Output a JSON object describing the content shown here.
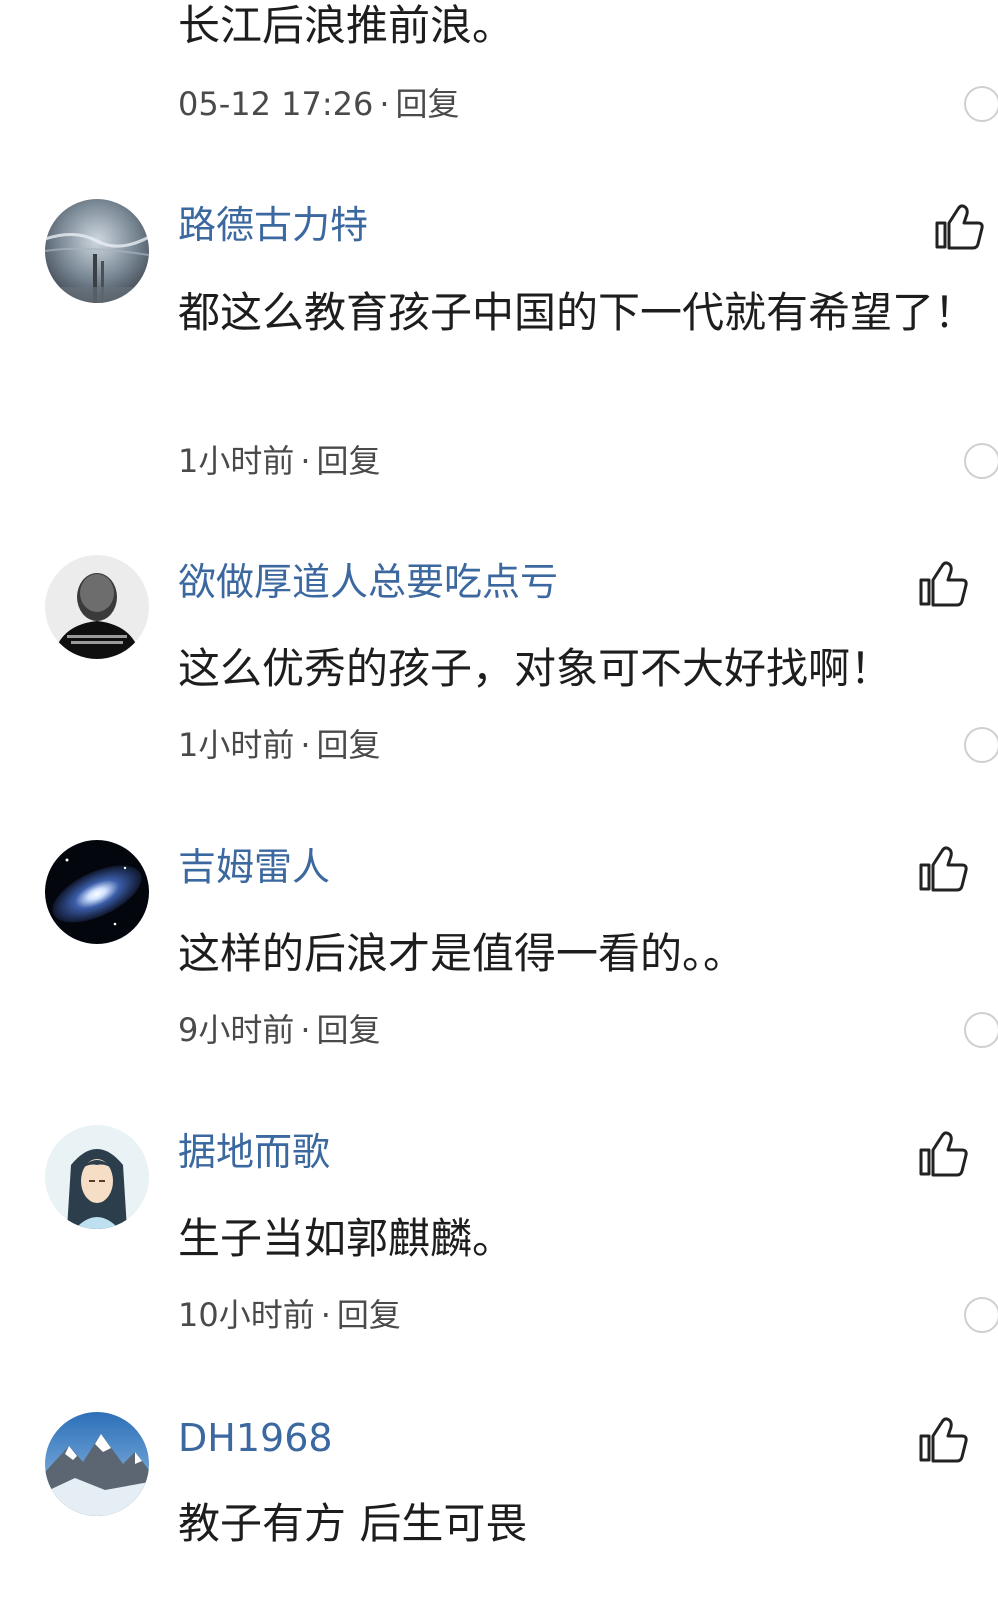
{
  "comments": [
    {
      "username": "",
      "text": "长江后浪推前浪。",
      "time": "05-12 17:26",
      "reply_label": "回复",
      "avatar": "none"
    },
    {
      "username": "路德古力特",
      "text": "都这么教育孩子中国的下一代就有希望了！",
      "time": "1小时前",
      "reply_label": "回复",
      "avatar": "city-skyline-avatar"
    },
    {
      "username": "欲做厚道人总要吃点亏",
      "text": "这么优秀的孩子，对象可不大好找啊！",
      "time": "1小时前",
      "reply_label": "回复",
      "avatar": "bald-man-portrait-avatar"
    },
    {
      "username": "吉姆雷人",
      "text": "这样的后浪才是值得一看的。。",
      "time": "9小时前",
      "reply_label": "回复",
      "avatar": "galaxy-avatar"
    },
    {
      "username": "据地而歌",
      "text": "生子当如郭麒麟。",
      "time": "10小时前",
      "reply_label": "回复",
      "avatar": "anime-scholar-avatar"
    },
    {
      "username": "DH1968",
      "text": "教子有方 后生可畏",
      "time": "",
      "reply_label": "",
      "avatar": "snow-mountain-avatar"
    }
  ],
  "icons": {
    "like": "thumbs-up-icon",
    "more": "more-circle-icon"
  },
  "colors": {
    "username": "#3c68a0",
    "comment_text": "#1d1d1d",
    "meta_text": "#4a4a4a",
    "background": "#ffffff"
  }
}
